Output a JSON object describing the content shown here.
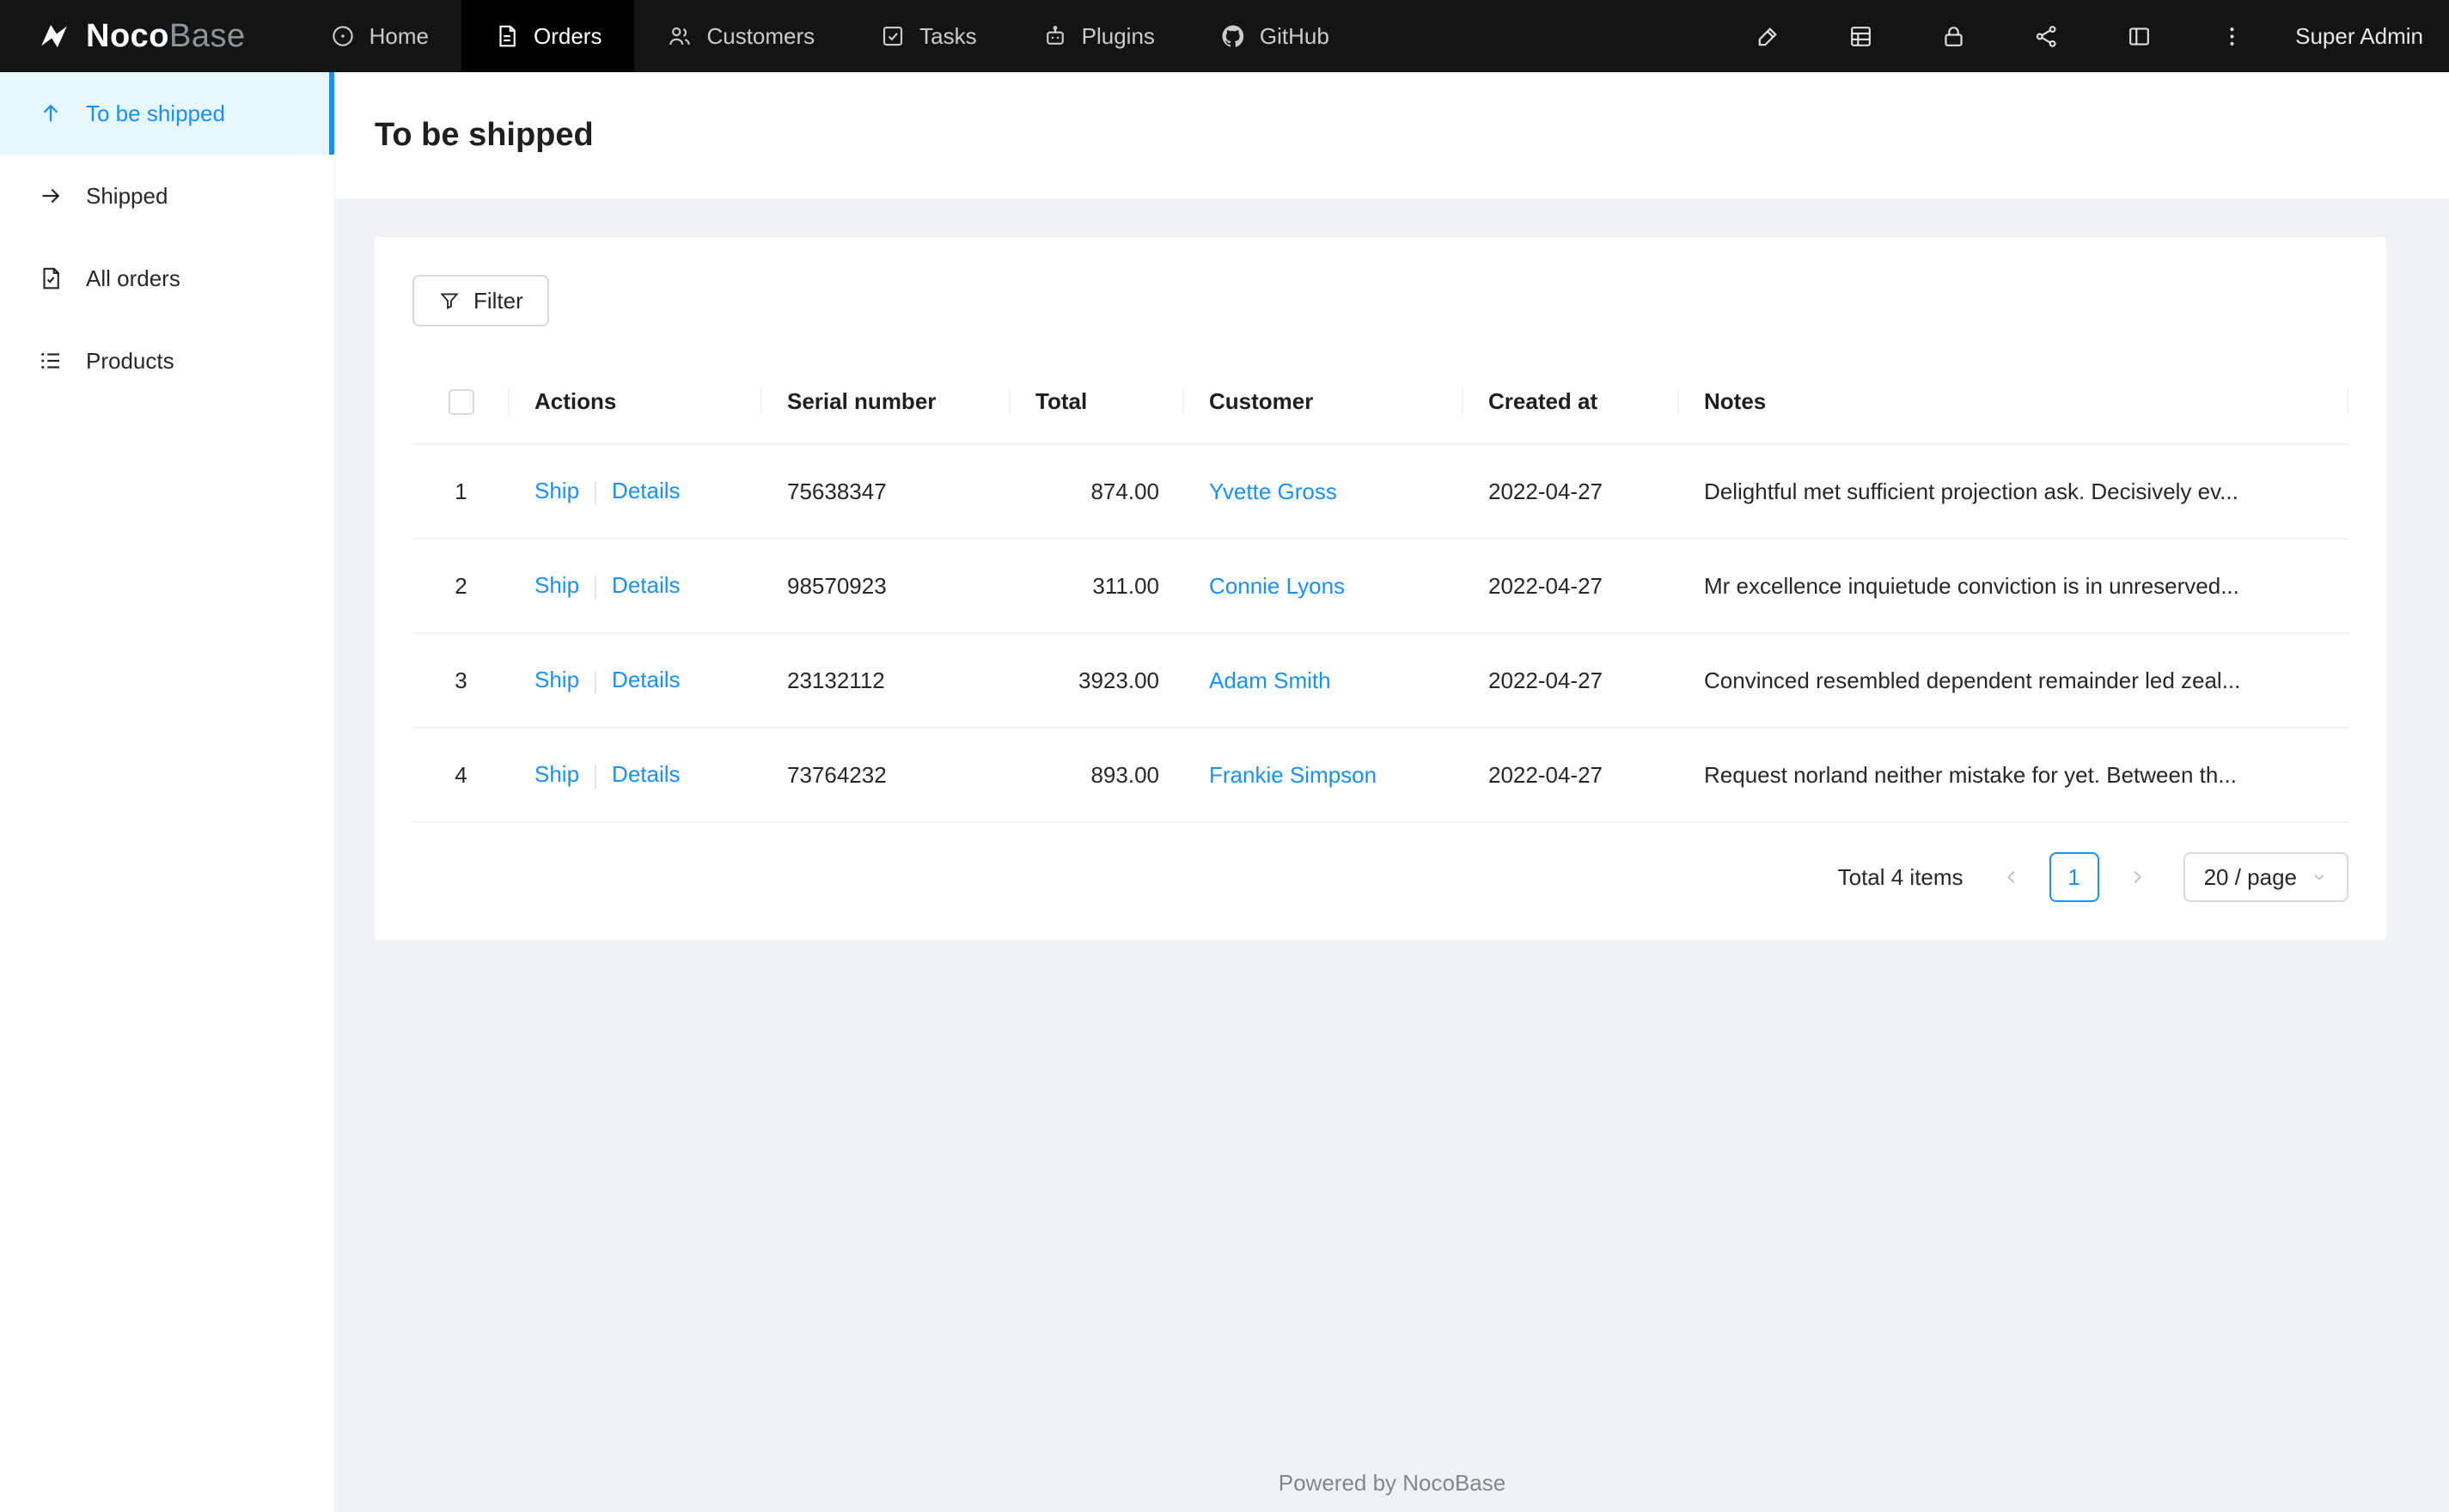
{
  "brand": {
    "bold": "Noco",
    "light": "Base"
  },
  "navbar": {
    "items": [
      {
        "label": "Home"
      },
      {
        "label": "Orders",
        "active": true
      },
      {
        "label": "Customers"
      },
      {
        "label": "Tasks"
      },
      {
        "label": "Plugins"
      },
      {
        "label": "GitHub"
      }
    ],
    "user": "Super Admin"
  },
  "sidebar": {
    "items": [
      {
        "label": "To be shipped",
        "active": true
      },
      {
        "label": "Shipped"
      },
      {
        "label": "All orders"
      },
      {
        "label": "Products"
      }
    ]
  },
  "page": {
    "title": "To be shipped"
  },
  "toolbar": {
    "filter_label": "Filter"
  },
  "table": {
    "columns": [
      "Actions",
      "Serial number",
      "Total",
      "Customer",
      "Created at",
      "Notes"
    ],
    "action_labels": {
      "ship": "Ship",
      "details": "Details"
    },
    "rows": [
      {
        "index": "1",
        "serial": "75638347",
        "total": "874.00",
        "customer": "Yvette Gross",
        "created": "2022-04-27",
        "notes": "Delightful met sufficient projection ask. Decisively ev..."
      },
      {
        "index": "2",
        "serial": "98570923",
        "total": "311.00",
        "customer": "Connie Lyons",
        "created": "2022-04-27",
        "notes": "Mr excellence inquietude conviction is in unreserved..."
      },
      {
        "index": "3",
        "serial": "23132112",
        "total": "3923.00",
        "customer": "Adam Smith",
        "created": "2022-04-27",
        "notes": "Convinced resembled dependent remainder led zeal..."
      },
      {
        "index": "4",
        "serial": "73764232",
        "total": "893.00",
        "customer": "Frankie Simpson",
        "created": "2022-04-27",
        "notes": "Request norland neither mistake for yet. Between th..."
      }
    ]
  },
  "pagination": {
    "total_text": "Total 4 items",
    "current_page": "1",
    "page_size": "20 / page"
  },
  "footer": {
    "text": "Powered by NocoBase"
  },
  "colors": {
    "accent": "#1890ff",
    "active_item_bg": "#e6f7ff",
    "navbar_bg": "#141414",
    "navbar_active_bg": "#000000",
    "content_bg": "#f0f2f5"
  }
}
